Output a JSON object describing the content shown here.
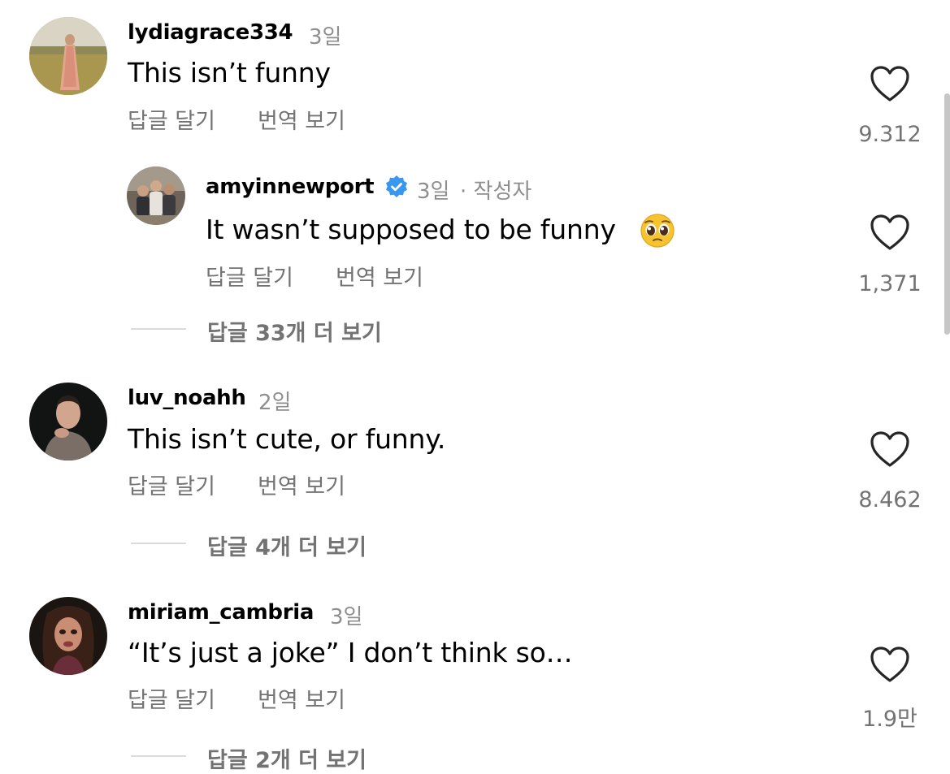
{
  "colors": {
    "text_primary": "#000000",
    "text_secondary": "#737373",
    "meta": "#8e8e8e",
    "verified": "#3897f0",
    "divider": "#dbdbdb"
  },
  "comments": [
    {
      "username": "lydiagrace334",
      "time": "3일",
      "text": "This isn’t funny",
      "reply_label": "답글 달기",
      "translate_label": "번역 보기",
      "likes": "9.312",
      "avatar_icon": "profile-photo-field-dress"
    },
    {
      "username": "amyinnewport",
      "verified_icon": "verified-badge-icon",
      "time": "3일",
      "author_tag": "· 작성자",
      "text": "It wasn’t supposed to be funny",
      "emoji": "pleading-face-emoji",
      "reply_label": "답글 달기",
      "translate_label": "번역 보기",
      "likes": "1,371",
      "avatar_icon": "profile-photo-family-group"
    },
    {
      "username": "luv_noahh",
      "time": "2일",
      "text": "This isn’t cute, or funny.",
      "reply_label": "답글 달기",
      "translate_label": "번역 보기",
      "likes": "8.462",
      "avatar_icon": "profile-photo-man-dark"
    },
    {
      "username": "miriam_cambria",
      "time": "3일",
      "text": "“It’s just a joke” I don’t think so…",
      "reply_label": "답글 달기",
      "translate_label": "번역 보기",
      "likes": "1.9만",
      "avatar_icon": "profile-photo-doll"
    }
  ],
  "view_replies": [
    "답글 33개 더 보기",
    "답글 4개 더 보기",
    "답글 2개 더 보기"
  ]
}
